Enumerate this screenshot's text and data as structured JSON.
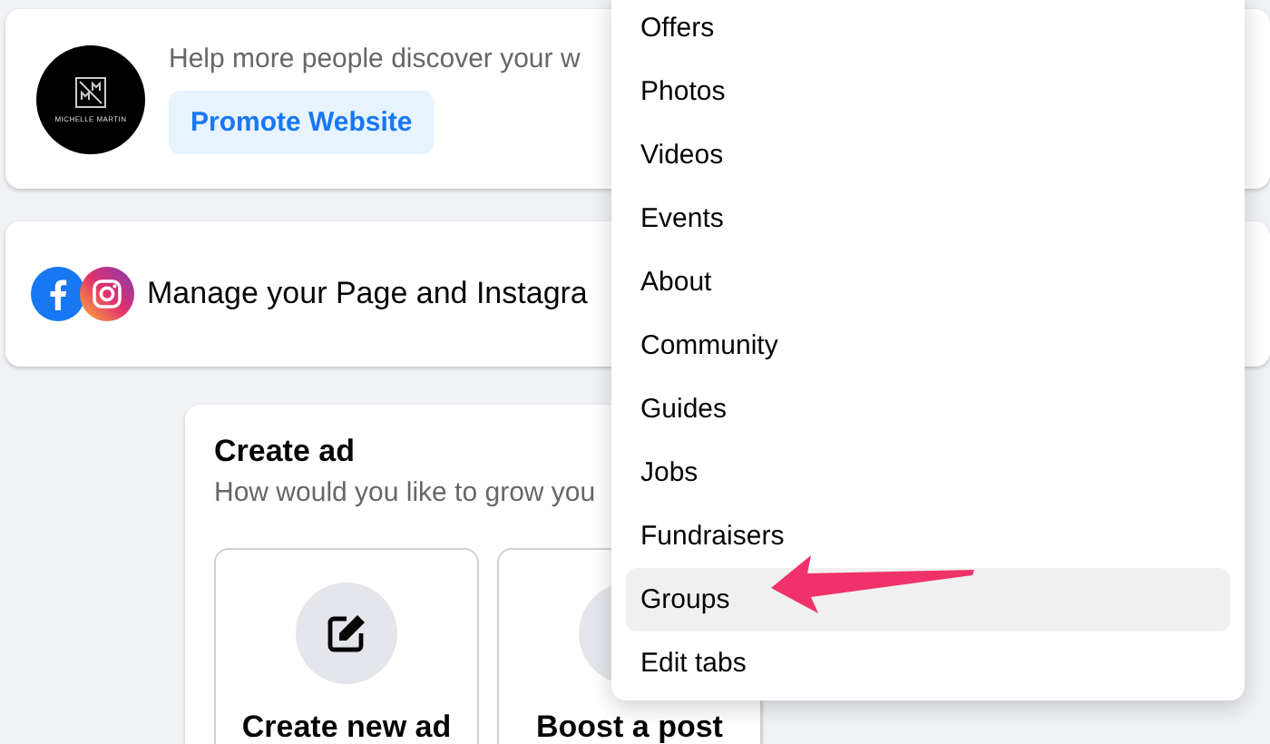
{
  "promote_card": {
    "avatar_text": "MICHELLE MARTIN",
    "message": "Help more people discover your w",
    "button": "Promote Website"
  },
  "manage_card": {
    "message": "Manage your Page and Instagra"
  },
  "create_ad": {
    "title": "Create ad",
    "subtitle": "How would you like to grow you",
    "options": [
      {
        "label": "Create new ad",
        "kind": "edit"
      },
      {
        "label": "Boost a post",
        "kind": "boost"
      }
    ]
  },
  "menu": {
    "items": [
      {
        "label": "Offers",
        "selected": false
      },
      {
        "label": "Photos",
        "selected": false
      },
      {
        "label": "Videos",
        "selected": false
      },
      {
        "label": "Events",
        "selected": false
      },
      {
        "label": "About",
        "selected": false
      },
      {
        "label": "Community",
        "selected": false
      },
      {
        "label": "Guides",
        "selected": false
      },
      {
        "label": "Jobs",
        "selected": false
      },
      {
        "label": "Fundraisers",
        "selected": false
      },
      {
        "label": "Groups",
        "selected": true
      },
      {
        "label": "Edit tabs",
        "selected": false
      }
    ]
  }
}
